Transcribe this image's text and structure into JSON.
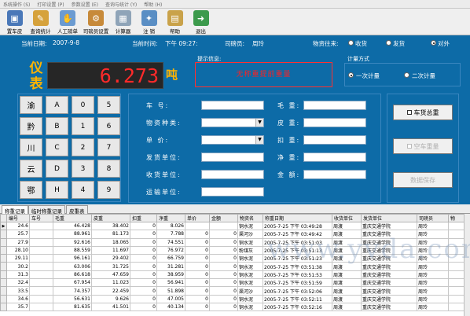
{
  "menu": [
    "系统操作 (S)",
    "打印设置 (P)",
    "参数设置 (E)",
    "查询与统计 (Y)",
    "帮助 (H)"
  ],
  "toolbar": [
    {
      "label": "置车皮",
      "icon": "truck-icon"
    },
    {
      "label": "查询统计",
      "icon": "query-icon"
    },
    {
      "label": "人工磅单",
      "icon": "manual-ticket-icon"
    },
    {
      "label": "司磅员设置",
      "icon": "operator-settings-icon"
    },
    {
      "label": "计算器",
      "icon": "calculator-icon"
    },
    {
      "label": "注 销",
      "icon": "logout-icon"
    },
    {
      "label": "帮助",
      "icon": "help-book-icon"
    },
    {
      "label": "退出",
      "icon": "exit-icon"
    }
  ],
  "info": {
    "date_label": "当前日期:",
    "date_value": "2007-9-8",
    "time_label": "当前时间:",
    "time_value": "下午 09:27:",
    "operator_label": "司磅员:",
    "operator_value": "周玲",
    "goods_flow_label": "物资往来:",
    "goods_flow_options": [
      "收货",
      "发货",
      "对外"
    ],
    "goods_flow_selected": 2
  },
  "weight": {
    "label": "仪表",
    "value": "6.273",
    "unit": "吨"
  },
  "prompt": {
    "label": "提示信息:",
    "text": "无称重提前重量"
  },
  "meter_mode": {
    "label": "计量方式",
    "options": [
      "一次计量",
      "二次计量"
    ],
    "selected": 0
  },
  "keypad": [
    [
      "渝",
      "A",
      "0",
      "5"
    ],
    [
      "黔",
      "B",
      "1",
      "6"
    ],
    [
      "川",
      "C",
      "2",
      "7"
    ],
    [
      "云",
      "D",
      "3",
      "8"
    ],
    [
      "鄂",
      "H",
      "4",
      "9"
    ]
  ],
  "form": {
    "left": [
      "车  号:",
      "物资种类:",
      "单  价:",
      "发货单位:",
      "收货单位:",
      "运输单位:"
    ],
    "right": [
      "毛 重:",
      "皮 重:",
      "扣 重:",
      "净 重:",
      "金 额:"
    ]
  },
  "right_buttons": [
    "车货总重",
    "空车重量",
    "数据保存"
  ],
  "tabs": [
    "称重记录",
    "临时称重记录",
    "皮重表"
  ],
  "table": {
    "headers": [
      "编号",
      "车号",
      "毛重",
      "皮重",
      "扣重",
      "净重",
      "单价",
      "金额",
      "物资名",
      "称重日期",
      "收货单位",
      "发货单位",
      "司磅员",
      "物"
    ],
    "rows": [
      [
        "24.6",
        "",
        "46.428",
        "38.402",
        "0",
        "8.026",
        "",
        "",
        "铜水泥",
        "2005-7-25 下午 03:49:28",
        "周渡",
        "重庆交通学院",
        "周玲",
        ""
      ],
      [
        "25.7",
        "",
        "88.961",
        "81.173",
        "0",
        "7.788",
        "0",
        "0",
        "渠河沙",
        "2005-7-25 下午 03:49:42",
        "周渡",
        "重庆交通学院",
        "周玲",
        ""
      ],
      [
        "27.9",
        "",
        "92.616",
        "18.065",
        "0",
        "74.551",
        "0",
        "0",
        "铜水泥",
        "2005-7-25 下午 03:51:03",
        "周渡",
        "重庆交通学院",
        "周玲",
        ""
      ],
      [
        "28.10",
        "",
        "88.559",
        "11.697",
        "0",
        "76.972",
        "0",
        "0",
        "粉煤灰",
        "2005-7-25 下午 03:51:13",
        "周渡",
        "重庆交通学院",
        "周玲",
        ""
      ],
      [
        "29.11",
        "",
        "96.161",
        "29.402",
        "0",
        "66.759",
        "0",
        "0",
        "铜水泥",
        "2005-7-25 下午 03:51:23",
        "周渡",
        "重庆交通学院",
        "周玲",
        ""
      ],
      [
        "30.2",
        "",
        "63.006",
        "31.725",
        "0",
        "31.281",
        "0",
        "0",
        "铜水泥",
        "2005-7-25 下午 03:51:38",
        "周渡",
        "重庆交通学院",
        "周玲",
        ""
      ],
      [
        "31.3",
        "",
        "86.618",
        "47.659",
        "0",
        "38.959",
        "0",
        "0",
        "铜水泥",
        "2005-7-25 下午 03:51:53",
        "周渡",
        "重庆交通学院",
        "周玲",
        ""
      ],
      [
        "32.4",
        "",
        "67.954",
        "11.023",
        "0",
        "56.941",
        "0",
        "0",
        "铜水泥",
        "2005-7-25 下午 03:51:59",
        "周渡",
        "重庆交通学院",
        "周玲",
        ""
      ],
      [
        "33.5",
        "",
        "74.357",
        "22.459",
        "0",
        "51.898",
        "0",
        "0",
        "渠河沙",
        "2005-7-25 下午 03:52:06",
        "周渡",
        "重庆交通学院",
        "周玲",
        ""
      ],
      [
        "34.6",
        "",
        "56.631",
        "9.626",
        "0",
        "47.005",
        "0",
        "0",
        "铜水泥",
        "2005-7-25 下午 03:52:11",
        "周渡",
        "重庆交通学院",
        "周玲",
        ""
      ],
      [
        "35.7",
        "",
        "81.635",
        "41.501",
        "0",
        "40.134",
        "0",
        "0",
        "铜水泥",
        "2005-7-25 下午 03:52:16",
        "周渡",
        "重庆交通学院",
        "周玲",
        ""
      ]
    ]
  },
  "watermark": "www.yvda.com",
  "colors": {
    "panel": "#0d6ba7",
    "weight_digits": "#ff2a2a",
    "title_orange": "#ffb400",
    "prompt_red": "#ff2020"
  }
}
